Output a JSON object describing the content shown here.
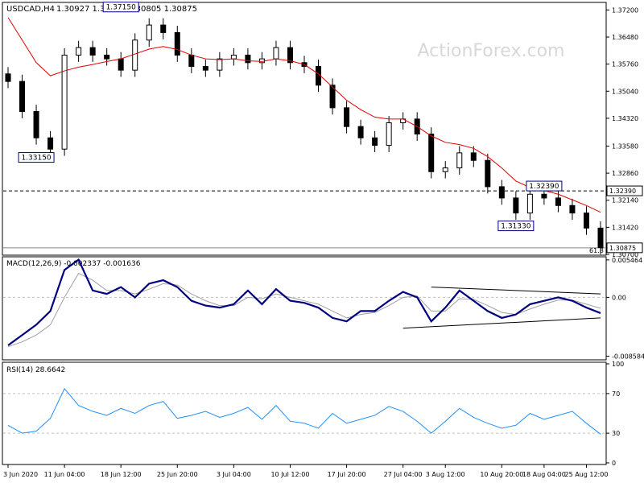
{
  "header": {
    "symbol": "USDCAD,H4",
    "ohlc": "1.30927 1.31003 1.30805 1.30875"
  },
  "watermark": "ActionForex.com",
  "colors": {
    "price": "#000000",
    "ma": "#e00000",
    "macd": "#000080",
    "signal": "#a0a0a0",
    "rsi": "#1e90ff",
    "grid": "#c0c0c0",
    "label_border": "#000080"
  },
  "chart_data": [
    {
      "type": "candlestick",
      "title": "USDCAD,H4",
      "ylim": [
        1.307,
        1.3738
      ],
      "y_ticks": [
        "1.37200",
        "1.36480",
        "1.35760",
        "1.35040",
        "1.34320",
        "1.33580",
        "1.32860",
        "1.32140",
        "1.31420",
        "1.30700"
      ],
      "y_tick_values": [
        1.372,
        1.3648,
        1.3576,
        1.3504,
        1.3432,
        1.3358,
        1.3286,
        1.3214,
        1.3142,
        1.307
      ],
      "series": [
        {
          "x": [
            "3 Jun",
            "5 Jun",
            "7 Jun",
            "9 Jun",
            "11 Jun",
            "13 Jun",
            "15 Jun",
            "17 Jun",
            "19 Jun",
            "21 Jun",
            "23 Jun",
            "25 Jun",
            "27 Jun",
            "29 Jun",
            "1 Jul",
            "3 Jul",
            "5 Jul",
            "7 Jul",
            "9 Jul",
            "11 Jul",
            "13 Jul",
            "15 Jul",
            "17 Jul",
            "19 Jul",
            "21 Jul",
            "23 Jul",
            "25 Jul",
            "27 Jul",
            "29 Jul",
            "31 Jul",
            "2 Aug",
            "4 Aug",
            "6 Aug",
            "8 Aug",
            "10 Aug",
            "12 Aug",
            "14 Aug",
            "16 Aug",
            "18 Aug",
            "20 Aug",
            "22 Aug",
            "24 Aug",
            "26 Aug"
          ],
          "close": [
            1.353,
            1.345,
            1.338,
            1.335,
            1.36,
            1.362,
            1.36,
            1.359,
            1.356,
            1.364,
            1.368,
            1.366,
            1.36,
            1.357,
            1.356,
            1.359,
            1.36,
            1.358,
            1.359,
            1.362,
            1.358,
            1.357,
            1.352,
            1.346,
            1.341,
            1.338,
            1.336,
            1.342,
            1.343,
            1.339,
            1.329,
            1.33,
            1.334,
            1.332,
            1.325,
            1.322,
            1.318,
            1.323,
            1.322,
            1.32,
            1.318,
            1.314,
            1.3088
          ]
        }
      ],
      "moving_average": [
        1.37,
        1.364,
        1.358,
        1.3545,
        1.3558,
        1.3568,
        1.3575,
        1.3583,
        1.359,
        1.3603,
        1.3616,
        1.3623,
        1.3615,
        1.36,
        1.359,
        1.3588,
        1.359,
        1.3585,
        1.3583,
        1.359,
        1.3585,
        1.3575,
        1.355,
        1.3515,
        1.348,
        1.3455,
        1.3435,
        1.343,
        1.343,
        1.341,
        1.3385,
        1.3368,
        1.3362,
        1.3352,
        1.333,
        1.33,
        1.3265,
        1.3248,
        1.324,
        1.323,
        1.3215,
        1.32,
        1.3182
      ],
      "annotations": [
        {
          "label": "1.37150",
          "value": 1.3715
        },
        {
          "label": "1.33150",
          "value": 1.3315
        },
        {
          "label": "1.32390",
          "value": 1.3239
        },
        {
          "label": "1.31330",
          "value": 1.3133
        }
      ],
      "horizontal_lines": [
        {
          "label": "1.32390",
          "value": 1.3239,
          "style": "dashed"
        },
        {
          "label": "1.30875",
          "value": 1.30875,
          "style": "solid"
        }
      ],
      "fib_label": "61.8"
    },
    {
      "type": "line",
      "title": "MACD(12,26,9) -0.002337 -0.001636",
      "ylim": [
        -0.009,
        0.0058
      ],
      "y_ticks": [
        "0.005464",
        "0.00",
        "-0.008584"
      ],
      "y_tick_values": [
        0.005464,
        0.0,
        -0.008584
      ],
      "series": [
        {
          "name": "MACD",
          "values": [
            -0.007,
            -0.0055,
            -0.004,
            -0.002,
            0.004,
            0.0055,
            0.001,
            0.0005,
            0.0015,
            0.0,
            0.002,
            0.0025,
            0.0015,
            -0.0005,
            -0.0012,
            -0.0015,
            -0.001,
            0.001,
            -0.001,
            0.0012,
            -0.0005,
            -0.0008,
            -0.0015,
            -0.003,
            -0.0035,
            -0.002,
            -0.002,
            -0.0005,
            0.0008,
            0.0,
            -0.0035,
            -0.0015,
            0.001,
            -0.0005,
            -0.002,
            -0.003,
            -0.0025,
            -0.001,
            -0.0005,
            0.0,
            -0.0005,
            -0.0015,
            -0.0023
          ]
        },
        {
          "name": "Signal",
          "values": [
            -0.0072,
            -0.0065,
            -0.0055,
            -0.004,
            0.0,
            0.0035,
            0.0025,
            0.001,
            0.001,
            0.0005,
            0.0012,
            0.002,
            0.0018,
            0.0005,
            -0.0005,
            -0.0012,
            -0.0012,
            0.0,
            -0.0002,
            0.0005,
            0.0,
            -0.0005,
            -0.001,
            -0.002,
            -0.003,
            -0.0025,
            -0.0022,
            -0.0012,
            0.0,
            0.0002,
            -0.002,
            -0.002,
            -0.0002,
            -0.0003,
            -0.0012,
            -0.0022,
            -0.0025,
            -0.0017,
            -0.001,
            -0.0004,
            -0.0004,
            -0.001,
            -0.0016
          ]
        }
      ],
      "trendlines": [
        {
          "from_index": 30,
          "to_index": 42,
          "from_value": 0.0015,
          "to_value": 0.0005
        },
        {
          "from_index": 28,
          "to_index": 42,
          "from_value": -0.0045,
          "to_value": -0.003
        }
      ]
    },
    {
      "type": "line",
      "title": "RSI(14) 28.6642",
      "ylim": [
        0,
        100
      ],
      "y_ticks": [
        "100",
        "70",
        "30",
        "0"
      ],
      "y_tick_values": [
        100,
        70,
        30,
        0
      ],
      "levels": [
        70,
        30
      ],
      "series": [
        {
          "name": "RSI",
          "values": [
            38,
            30,
            32,
            45,
            75,
            58,
            52,
            48,
            55,
            50,
            58,
            62,
            45,
            48,
            52,
            46,
            50,
            56,
            44,
            58,
            42,
            40,
            35,
            50,
            40,
            44,
            48,
            57,
            52,
            42,
            30,
            42,
            55,
            46,
            40,
            35,
            38,
            50,
            44,
            48,
            52,
            40,
            29
          ]
        }
      ]
    }
  ],
  "x_axis_labels": [
    "3 Jun 2020",
    "11 Jun 04:00",
    "18 Jun 12:00",
    "25 Jun 20:00",
    "3 Jul 04:00",
    "10 Jul 12:00",
    "17 Jul 20:00",
    "27 Jul 04:00",
    "3 Aug 12:00",
    "10 Aug 20:00",
    "18 Aug 04:00",
    "25 Aug 12:00"
  ],
  "x_axis_label_indices": [
    0,
    4,
    8,
    12,
    16,
    20,
    24,
    28,
    31,
    35,
    38,
    41
  ]
}
